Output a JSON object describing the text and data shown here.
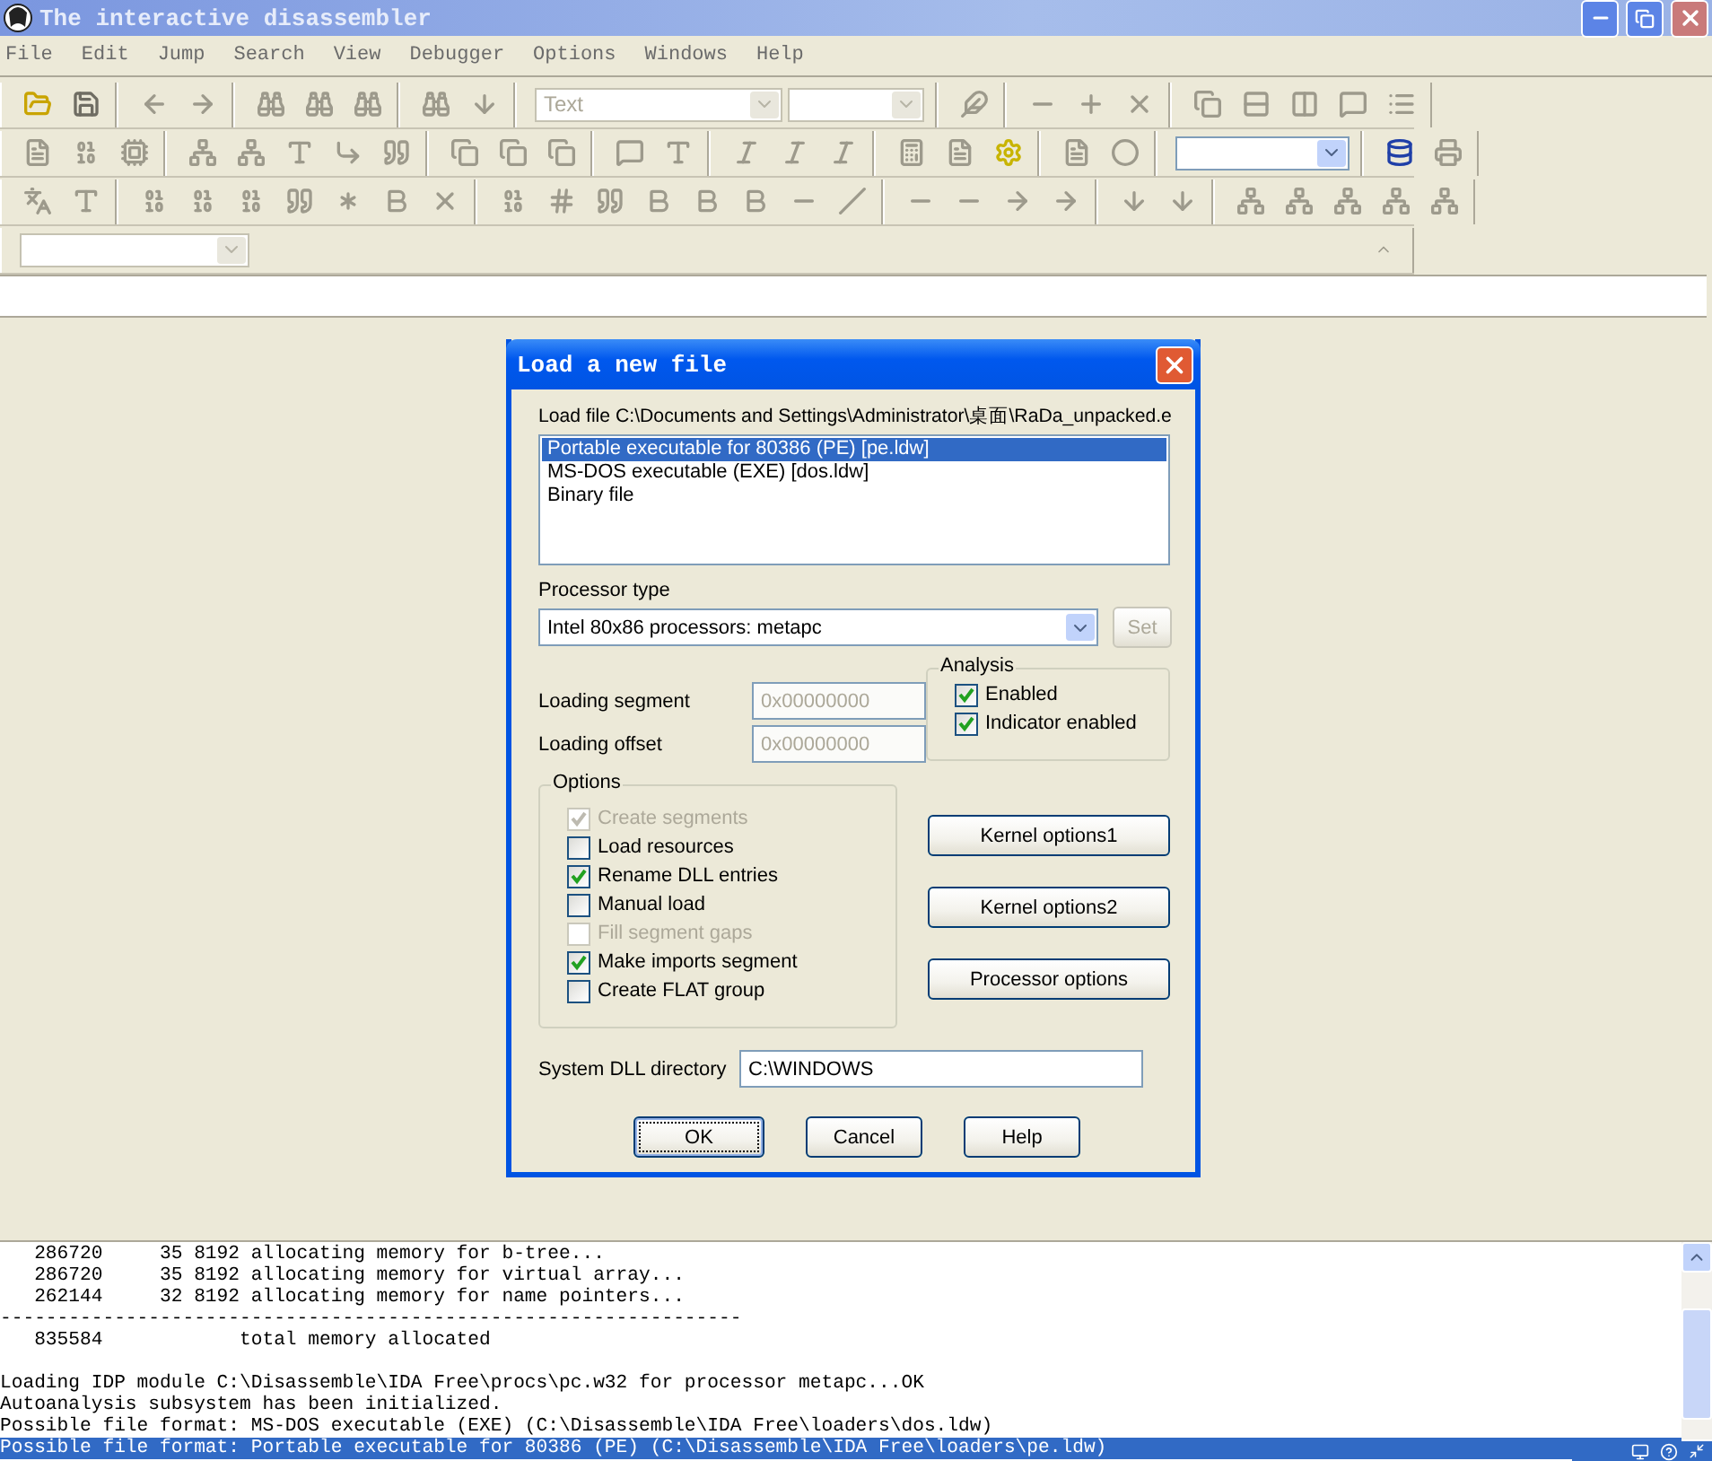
{
  "window": {
    "title": "The interactive disassembler"
  },
  "menu": [
    "File",
    "Edit",
    "Jump",
    "Search",
    "View",
    "Debugger",
    "Options",
    "Windows",
    "Help"
  ],
  "toolbar": {
    "type_combo": {
      "value": "Text",
      "disabled": true
    }
  },
  "dialog": {
    "title": "Load a new file",
    "load_file_label": "Load file C:\\Documents and Settings\\Administrator\\桌面\\RaDa_unpacked.e",
    "formats": [
      {
        "label": "Portable executable for 80386 (PE) [pe.ldw]",
        "selected": true
      },
      {
        "label": "MS-DOS executable (EXE) [dos.ldw]",
        "selected": false
      },
      {
        "label": "Binary file",
        "selected": false
      }
    ],
    "processor_label": "Processor type",
    "processor_value": "Intel 80x86 processors: metapc",
    "set_button": {
      "label": "Set",
      "disabled": true
    },
    "fields": [
      {
        "label": "Loading segment",
        "value": "0x00000000",
        "disabled": true
      },
      {
        "label": "Loading offset",
        "value": "0x00000000",
        "disabled": true
      }
    ],
    "analysis": {
      "title": "Analysis",
      "items": [
        {
          "label": "Enabled",
          "checked": true,
          "disabled": false
        },
        {
          "label": "Indicator enabled",
          "checked": true,
          "disabled": false
        }
      ]
    },
    "options": {
      "title": "Options",
      "items": [
        {
          "label": "Create segments",
          "checked": true,
          "disabled": true
        },
        {
          "label": "Load resources",
          "checked": false,
          "disabled": false
        },
        {
          "label": "Rename DLL entries",
          "checked": true,
          "disabled": false
        },
        {
          "label": "Manual load",
          "checked": false,
          "disabled": false
        },
        {
          "label": "Fill segment gaps",
          "checked": false,
          "disabled": true
        },
        {
          "label": "Make imports segment",
          "checked": true,
          "disabled": false
        },
        {
          "label": "Create FLAT group",
          "checked": false,
          "disabled": false
        }
      ]
    },
    "side_buttons": [
      "Kernel options1",
      "Kernel options2",
      "Processor options"
    ],
    "dll_directory": {
      "label": "System DLL directory",
      "value": "C:\\WINDOWS"
    },
    "buttons": [
      {
        "label": "OK",
        "default": true
      },
      {
        "label": "Cancel",
        "default": false
      },
      {
        "label": "Help",
        "default": false
      }
    ]
  },
  "log": {
    "lines": [
      {
        "text": "   286720     35 8192 allocating memory for b-tree...",
        "selected": false,
        "gap_before": false
      },
      {
        "text": "   286720     35 8192 allocating memory for virtual array...",
        "selected": false,
        "gap_before": false
      },
      {
        "text": "   262144     32 8192 allocating memory for name pointers...",
        "selected": false,
        "gap_before": false
      },
      {
        "text": "-----------------------------------------------------------------",
        "selected": false,
        "gap_before": false
      },
      {
        "text": "   835584            total memory allocated",
        "selected": false,
        "gap_before": false
      },
      {
        "text": "Loading IDP module C:\\Disassemble\\IDA Free\\procs\\pc.w32 for processor metapc...OK",
        "selected": false,
        "gap_before": true
      },
      {
        "text": "Autoanalysis subsystem has been initialized.",
        "selected": false,
        "gap_before": false
      },
      {
        "text": "Possible file format: MS-DOS executable (EXE) (C:\\Disassemble\\IDA Free\\loaders\\dos.ldw)",
        "selected": false,
        "gap_before": false
      },
      {
        "text": "Possible file format: Portable executable for 80386 (PE) (C:\\Disassemble\\IDA Free\\loaders\\pe.ldw)",
        "selected": true,
        "gap_before": false
      }
    ]
  }
}
